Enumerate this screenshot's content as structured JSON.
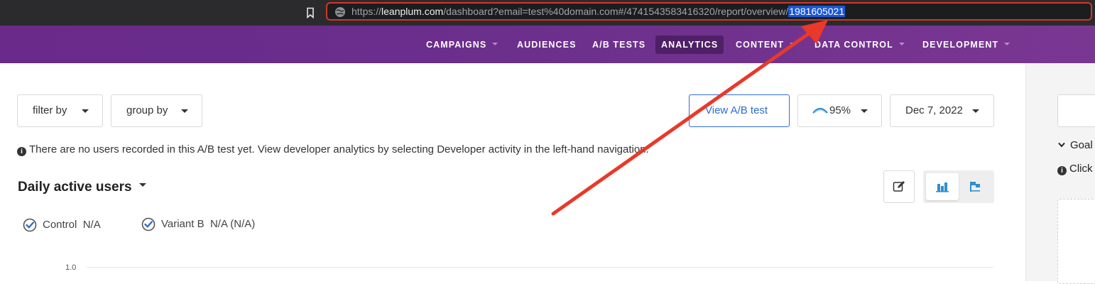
{
  "browser": {
    "url_scheme": "https://",
    "url_host": "leanplum.com",
    "url_path": "/dashboard?email=test%40domain.com#/4741543583416320/report/overview/",
    "url_selected": "1981605021"
  },
  "nav": {
    "items": [
      {
        "label": "CAMPAIGNS",
        "has_caret": true
      },
      {
        "label": "AUDIENCES",
        "has_caret": false
      },
      {
        "label": "A/B TESTS",
        "has_caret": false
      },
      {
        "label": "ANALYTICS",
        "has_caret": false,
        "active": true
      },
      {
        "label": "CONTENT",
        "has_caret": true
      },
      {
        "label": "DATA CONTROL",
        "has_caret": true
      },
      {
        "label": "DEVELOPMENT",
        "has_caret": true
      }
    ]
  },
  "toolbar": {
    "filter_label": "filter by",
    "group_label": "group by",
    "view_ab_label": "View A/B test",
    "confidence_label": "95%",
    "date_label": "Dec 7, 2022"
  },
  "notice": {
    "text": "There are no users recorded in this A/B test yet. View developer analytics by selecting Developer activity in the left-hand navigation."
  },
  "chart": {
    "title": "Daily active users",
    "legend": [
      {
        "name": "Control",
        "value": "N/A"
      },
      {
        "name": "Variant B",
        "value": "N/A (N/A)"
      }
    ],
    "y_tick": "1.0"
  },
  "right_panel": {
    "goal_label": "Goal",
    "click_label": "Click"
  },
  "colors": {
    "accent": "#2f6dd0",
    "nav_purple": "#6b2f8c",
    "annotation_red": "#e8392a"
  },
  "chart_data": {
    "type": "bar",
    "series": [
      {
        "name": "Control",
        "values": []
      },
      {
        "name": "Variant B",
        "values": []
      }
    ],
    "yticks": [
      "1.0"
    ]
  }
}
